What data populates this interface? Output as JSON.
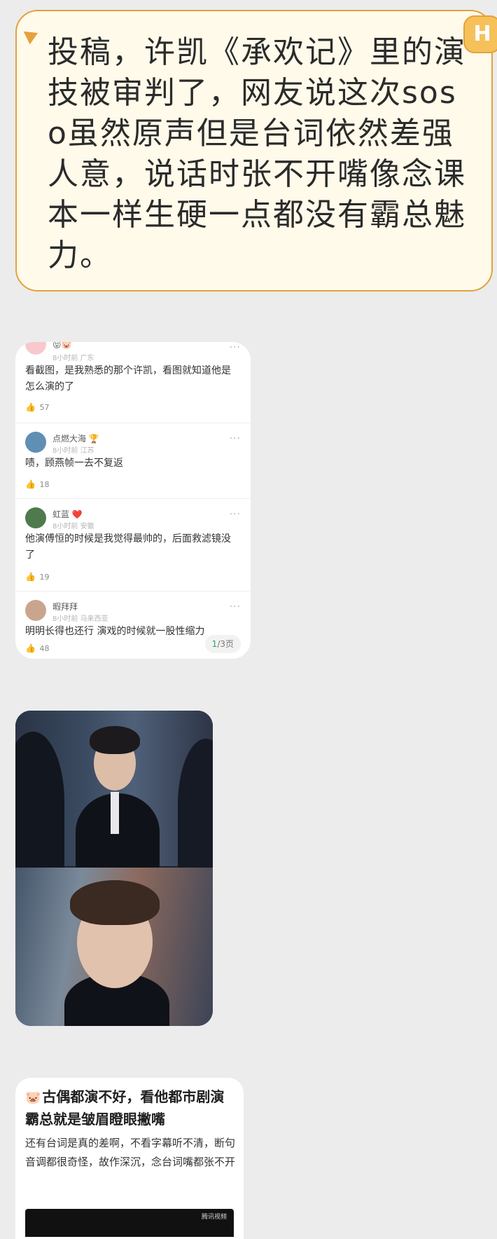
{
  "post_text": "投稿，许凯《承欢记》里的演技被审判了，网友说这次soso虽然原声但是台词依然差强人意，说话时张不开嘴像念课本一样生硬一点都没有霸总魅力。",
  "badge_glyph": "H",
  "comments": [
    {
      "username": "",
      "username_emoji": "😝🐷",
      "time": "8小时前",
      "location": "广东",
      "text": "看截图，是我熟悉的那个许凯，看图就知道他是怎么演的了",
      "likes": "57",
      "avatar_color": "#f7c9cf"
    },
    {
      "username": "点燃大海",
      "username_emoji": "🏆",
      "time": "8小时前",
      "location": "江苏",
      "text": "啧，顾燕帧一去不复返",
      "likes": "18",
      "avatar_color": "#5f8fb3"
    },
    {
      "username": "虹蓝",
      "username_emoji": "❤️",
      "time": "8小时前",
      "location": "安徽",
      "text": "他演傅恒的时候是我觉得最帅的，后面救滤镜没了",
      "likes": "19",
      "avatar_color": "#4e7a4e"
    },
    {
      "username": "暇拜拜",
      "username_emoji": "",
      "time": "8小时前",
      "location": "马来西亚",
      "text": "明明长得也还行 演戏的时候就一股性缩力",
      "likes": "48",
      "avatar_color": "#c9a58d"
    }
  ],
  "pager": {
    "current": "1",
    "total": "/3页"
  },
  "more_glyph": "···",
  "like_glyph": "👍",
  "post_card": {
    "emoji": "🐷",
    "title": "古偶都演不好，看他都市剧演霸总就是皱眉瞪眼撇嘴",
    "body": "还有台词是真的差啊，不看字幕听不清，断句音调都很奇怪，故作深沉，念台词嘴都张不开",
    "video_logo": "腾讯视频"
  }
}
